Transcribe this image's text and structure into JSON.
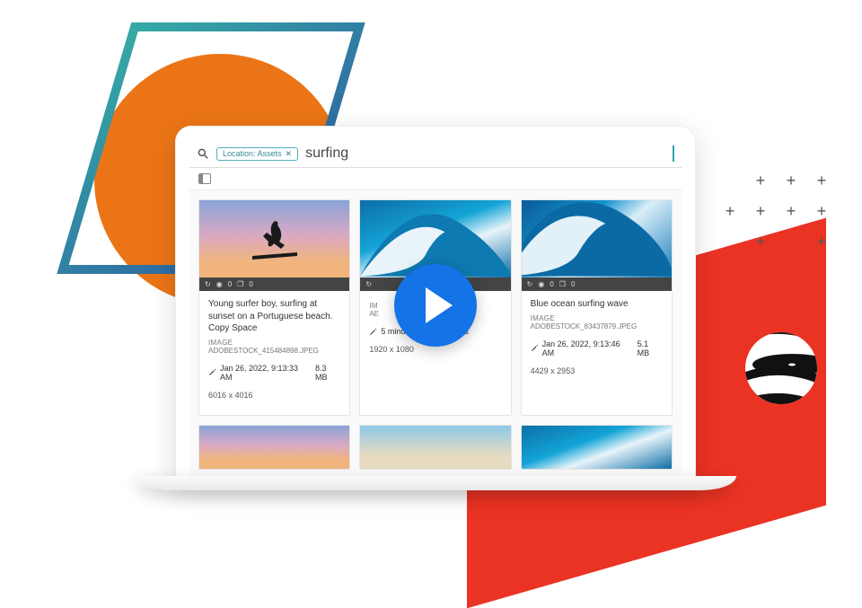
{
  "search": {
    "chip_label": "Location: Assets",
    "query": "surfing"
  },
  "meta_icons": {
    "refresh": "↻",
    "eye": "◉",
    "count0": "0",
    "layers": "❐",
    "count1": "0"
  },
  "cards": [
    {
      "title": "Young surfer boy, surfing at sunset on a Portuguese beach. Copy Space",
      "type": "IMAGE",
      "filename": "ADOBESTOCK_415484898.JPEG",
      "modified": "Jan 26, 2022, 9:13:33 AM",
      "size": "8.3 MB",
      "dimensions": "6016 x 4016"
    },
    {
      "title": "",
      "type": "IM",
      "filename": "AE",
      "modified": "5 minutes ago",
      "size": "435.1 KB",
      "dimensions": "1920 x 1080"
    },
    {
      "title": "Blue ocean surfing wave",
      "type": "IMAGE",
      "filename": "ADOBESTOCK_83437879.JPEG",
      "modified": "Jan 26, 2022, 9:13:46 AM",
      "size": "5.1 MB",
      "dimensions": "4429 x 2953"
    }
  ],
  "colors": {
    "accent": "#1473e6",
    "orange": "#eb7516",
    "red": "#eb3323"
  }
}
